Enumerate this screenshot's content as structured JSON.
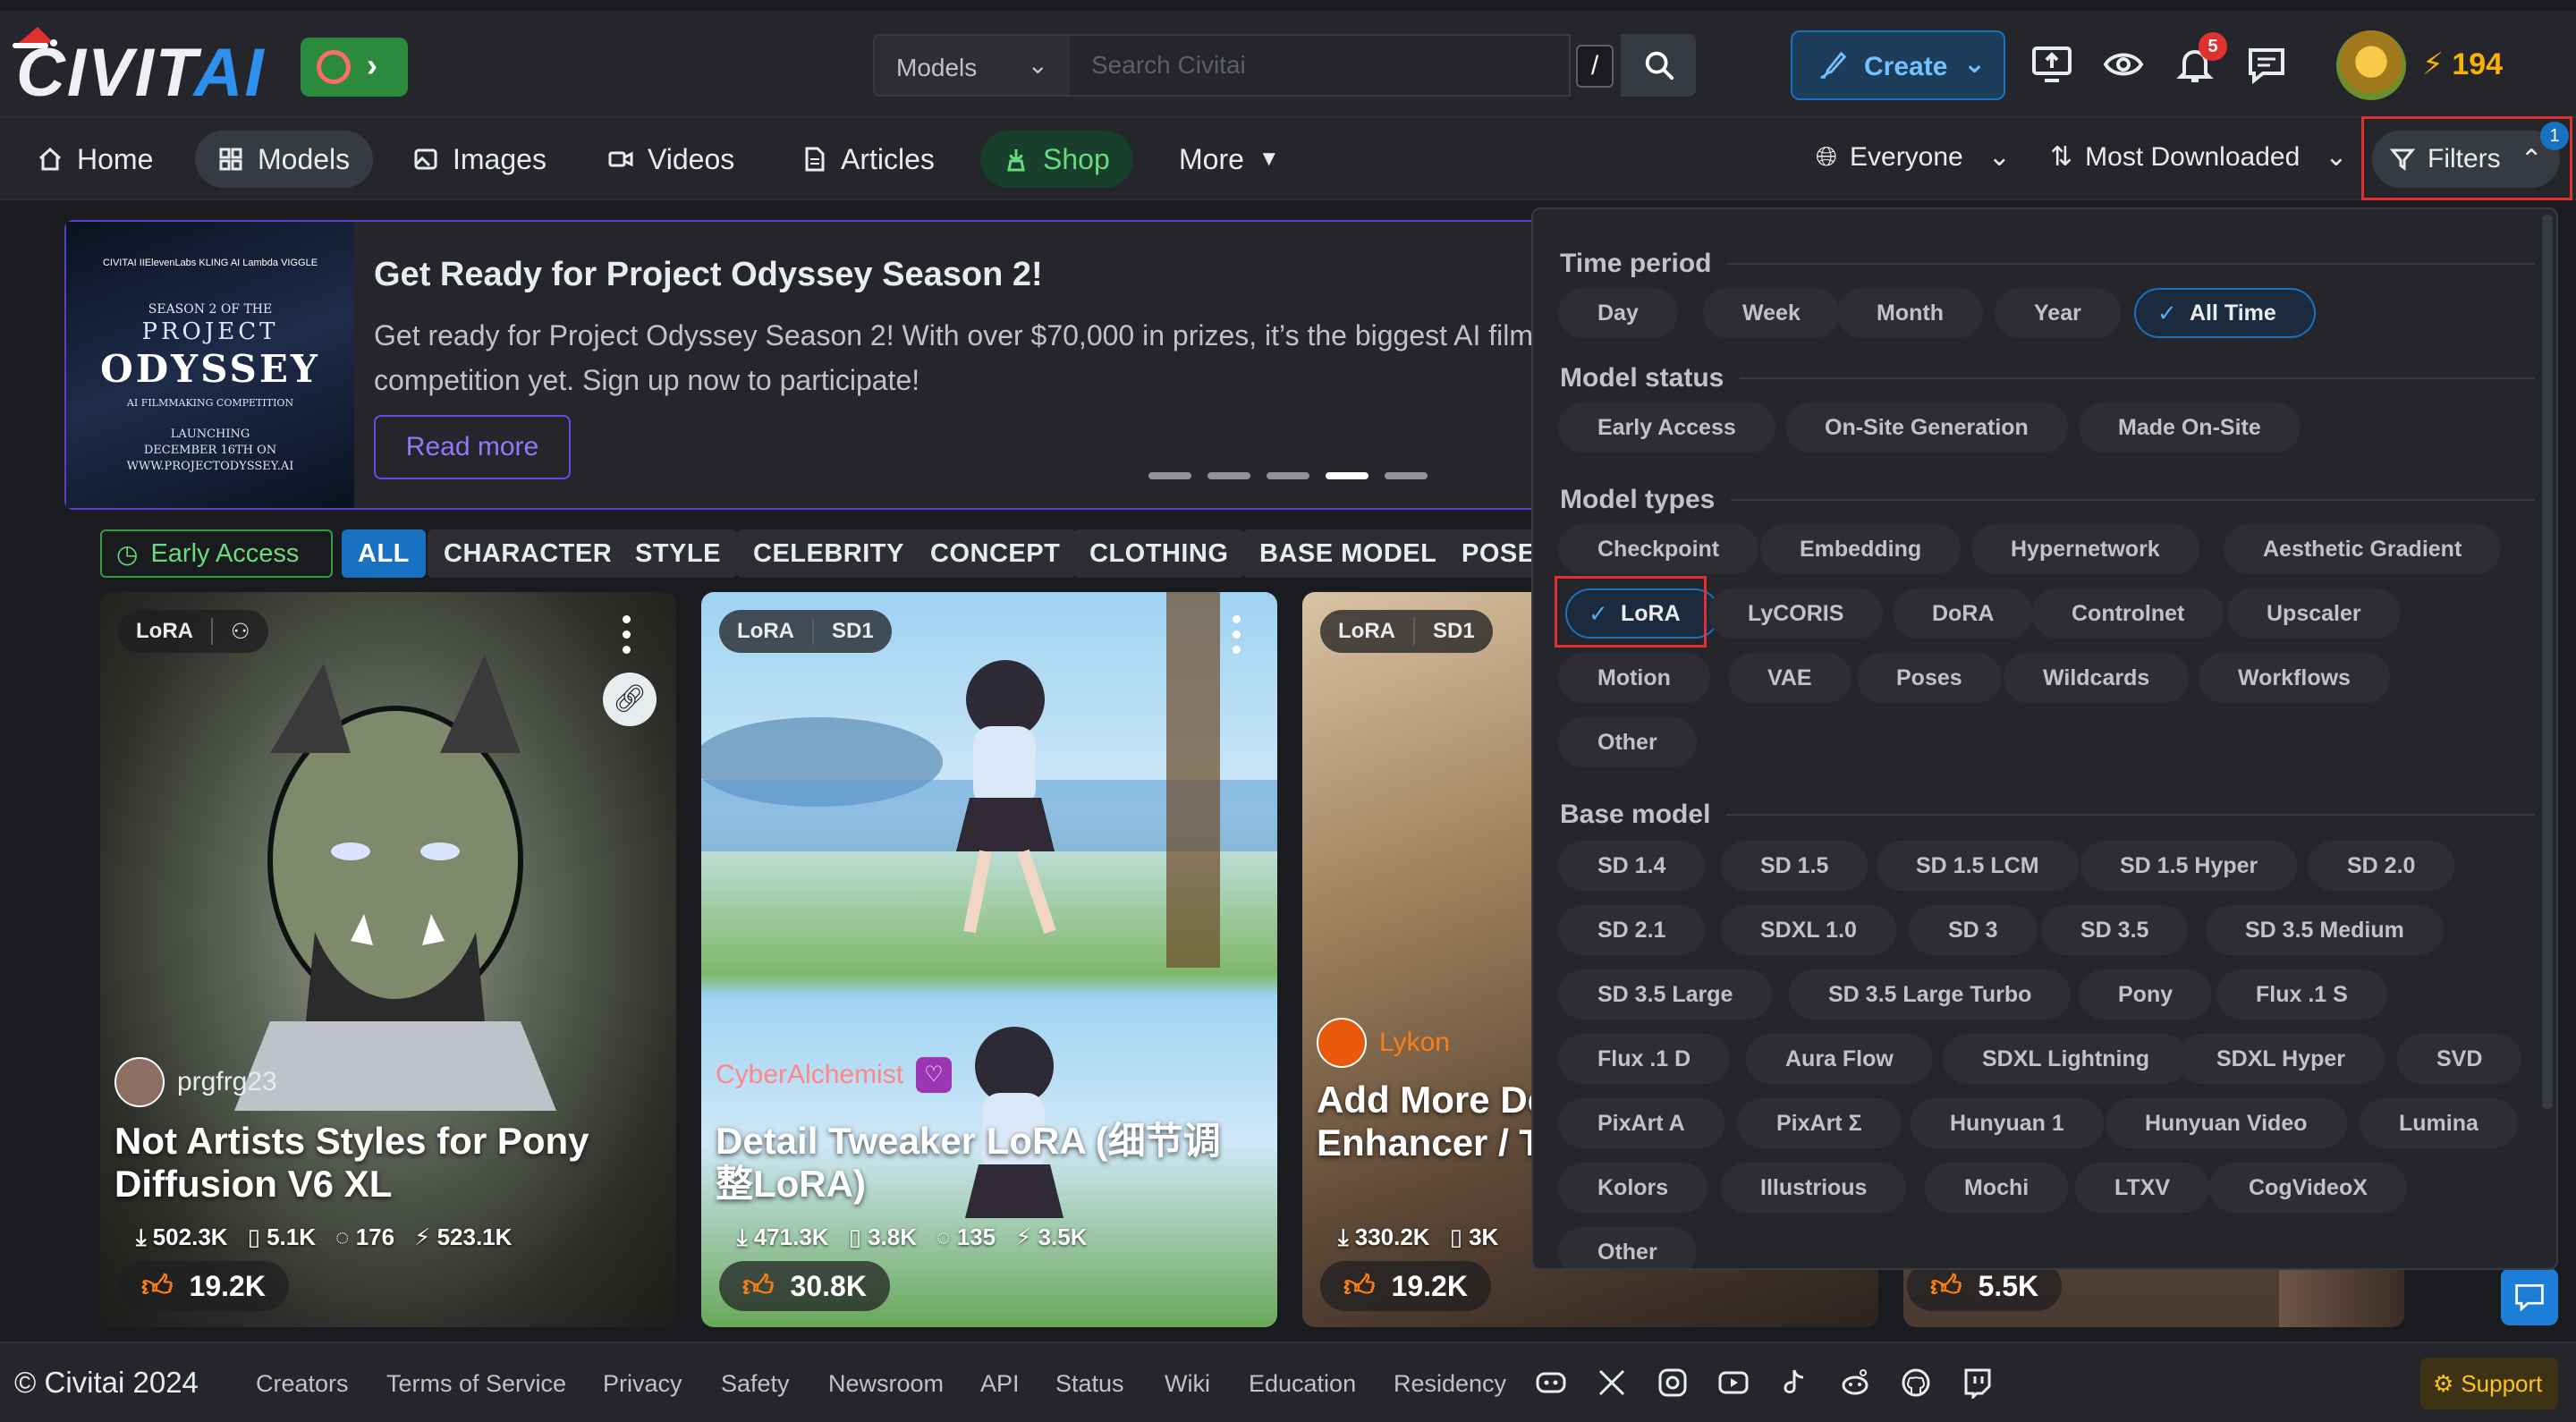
{
  "brand": {
    "logo_main": "CIVIT",
    "logo_accent": "AI"
  },
  "search": {
    "category": "Models",
    "placeholder": "Search Civitai",
    "shortcut": "/"
  },
  "header": {
    "create_label": "Create",
    "notifications_count": "5",
    "buzz_amount": "194"
  },
  "nav": {
    "items": [
      {
        "label": "Home"
      },
      {
        "label": "Models"
      },
      {
        "label": "Images"
      },
      {
        "label": "Videos"
      },
      {
        "label": "Articles"
      },
      {
        "label": "Shop"
      },
      {
        "label": "More"
      }
    ],
    "audience": "Everyone",
    "sort": "Most Downloaded",
    "filters_label": "Filters",
    "filters_count": "1"
  },
  "banner": {
    "image_lines": [
      "CIVITAI  IIElevenLabs  KLING AI  Lambda  VIGGLE",
      "SEASON 2 OF THE",
      "PROJECT",
      "ODYSSEY",
      "AI FILMMAKING COMPETITION",
      "LAUNCHING",
      "DECEMBER 16TH ON",
      "WWW.PROJECTODYSSEY.AI"
    ],
    "title": "Get Ready for Project Odyssey Season 2!",
    "text": "Get ready for Project Odyssey Season 2! With over $70,000 in prizes, it’s the biggest AI film competition yet. Sign up now to participate!",
    "button": "Read more"
  },
  "categories": {
    "early_access": "Early Access",
    "items": [
      "ALL",
      "CHARACTER",
      "STYLE",
      "CELEBRITY",
      "CONCEPT",
      "CLOTHING",
      "BASE MODEL",
      "POSES"
    ]
  },
  "cards": [
    {
      "tags": [
        "LoRA"
      ],
      "user": "prgfrg23",
      "title": "Not Artists Styles for Pony Diffusion V6 XL",
      "downloads": "502.3K",
      "saves": "5.1K",
      "comments": "176",
      "buzz": "523.1K",
      "likes": "19.2K"
    },
    {
      "tags": [
        "LoRA",
        "SD1"
      ],
      "user": "CyberAlchemist",
      "title": "Detail Tweaker LoRA (细节调整LoRA)",
      "downloads": "471.3K",
      "saves": "3.8K",
      "comments": "135",
      "buzz": "3.5K",
      "likes": "30.8K"
    },
    {
      "tags": [
        "LoRA",
        "SD1"
      ],
      "user": "Lykon",
      "title": "Add More Details - Detail Enhancer / Tweaker LoRA",
      "downloads": "330.2K",
      "saves": "3K",
      "likes": "19.2K"
    },
    {
      "likes": "5.5K"
    }
  ],
  "filters": {
    "time_period": {
      "title": "Time period",
      "options": [
        "Day",
        "Week",
        "Month",
        "Year",
        "All Time"
      ],
      "selected": "All Time"
    },
    "model_status": {
      "title": "Model status",
      "options": [
        "Early Access",
        "On-Site Generation",
        "Made On-Site"
      ]
    },
    "model_types": {
      "title": "Model types",
      "options": [
        "Checkpoint",
        "Embedding",
        "Hypernetwork",
        "Aesthetic Gradient",
        "LoRA",
        "LyCORIS",
        "DoRA",
        "Controlnet",
        "Upscaler",
        "Motion",
        "VAE",
        "Poses",
        "Wildcards",
        "Workflows",
        "Other"
      ],
      "selected": "LoRA"
    },
    "base_model": {
      "title": "Base model",
      "options": [
        "SD 1.4",
        "SD 1.5",
        "SD 1.5 LCM",
        "SD 1.5 Hyper",
        "SD 2.0",
        "SD 2.1",
        "SDXL 1.0",
        "SD 3",
        "SD 3.5",
        "SD 3.5 Medium",
        "SD 3.5 Large",
        "SD 3.5 Large Turbo",
        "Pony",
        "Flux .1 S",
        "Flux .1 D",
        "Aura Flow",
        "SDXL Lightning",
        "SDXL Hyper",
        "SVD",
        "PixArt A",
        "PixArt Σ",
        "Hunyuan 1",
        "Hunyuan Video",
        "Lumina",
        "Kolors",
        "Illustrious",
        "Mochi",
        "LTXV",
        "CogVideoX",
        "Other"
      ]
    }
  },
  "footer": {
    "copyright": "© Civitai 2024",
    "links": [
      "Creators",
      "Terms of Service",
      "Privacy",
      "Safety",
      "Newsroom",
      "API",
      "Status",
      "Wiki",
      "Education",
      "Residency"
    ],
    "socials": [
      "discord-icon",
      "x-icon",
      "instagram-icon",
      "youtube-icon",
      "tiktok-icon",
      "reddit-icon",
      "github-icon",
      "twitch-icon"
    ],
    "support": "Support"
  },
  "colors": {
    "background": "#1a1b1e",
    "surface": "#25262b",
    "accent_blue": "#1971c2",
    "buzz": "#fab005",
    "highlight_red": "#e03131"
  }
}
